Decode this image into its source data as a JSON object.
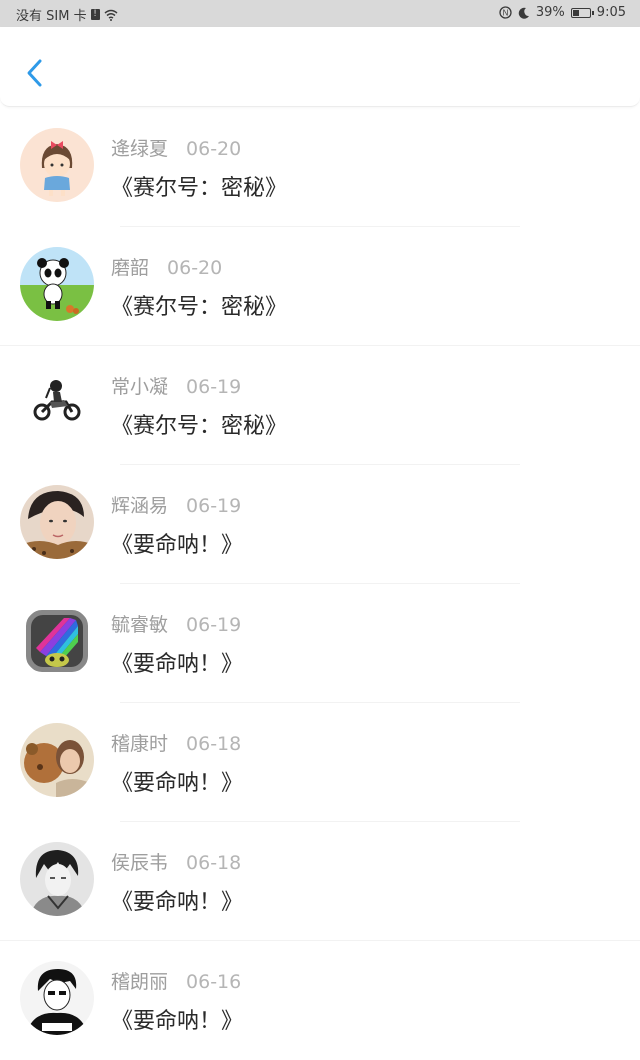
{
  "status_bar": {
    "carrier": "没有 SIM 卡",
    "sim_icon_text": "!",
    "battery": "39%",
    "time": "9:05"
  },
  "icons": {
    "back": "chevron-left-icon",
    "wifi": "wifi-icon",
    "nfc": "nfc-icon",
    "moon": "moon-icon",
    "battery": "battery-icon"
  },
  "colors": {
    "accent": "#2e9ae8",
    "status_bg": "#d9d9d9",
    "name_text": "#9e9e9e",
    "title_text": "#2a2a2a"
  },
  "comments": [
    {
      "name": "逄绿夏",
      "date": "06-20",
      "title": "《赛尔号：密秘》"
    },
    {
      "name": "磨韶",
      "date": "06-20",
      "title": "《赛尔号：密秘》"
    },
    {
      "name": "常小凝",
      "date": "06-19",
      "title": "《赛尔号：密秘》"
    },
    {
      "name": "辉涵易",
      "date": "06-19",
      "title": "《要命呐！》"
    },
    {
      "name": "毓睿敏",
      "date": "06-19",
      "title": "《要命呐！》"
    },
    {
      "name": "稽康时",
      "date": "06-18",
      "title": "《要命呐！》"
    },
    {
      "name": "侯辰韦",
      "date": "06-18",
      "title": "《要命呐！》"
    },
    {
      "name": "稽朗丽",
      "date": "06-16",
      "title": "《要命呐！》"
    }
  ]
}
